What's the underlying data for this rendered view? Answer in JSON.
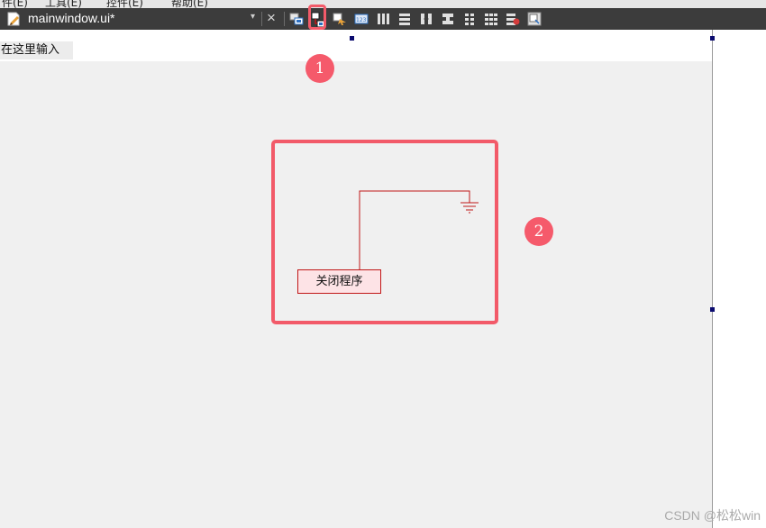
{
  "menu": {
    "items": [
      "件(E)",
      "工具(E)",
      "控件(E)",
      "帮助(E)"
    ]
  },
  "toolbar": {
    "document_title": "mainwindow.ui*",
    "close_symbol": "×",
    "dropdown_symbol": "▾",
    "icons": [
      "edit-widgets-icon",
      "edit-signals-slots-icon",
      "edit-buddies-icon",
      "edit-tab-order-icon",
      "layout-horizontal-icon",
      "layout-vertical-icon",
      "layout-horizontal-splitter-icon",
      "layout-vertical-splitter-icon",
      "layout-form-icon",
      "layout-grid-icon",
      "break-layout-icon",
      "adjust-size-icon"
    ],
    "highlighted_icon": "edit-signals-slots-icon"
  },
  "form": {
    "menubar_placeholder": "在这里输入",
    "button_label": "关闭程序"
  },
  "callouts": {
    "one": "1",
    "two": "2"
  },
  "colors": {
    "toolbar_bg": "#3c3c3c",
    "canvas_bg": "#f0f0f0",
    "highlight": "#f25a69",
    "connection": "#c01717"
  },
  "watermark": "CSDN @松松win"
}
